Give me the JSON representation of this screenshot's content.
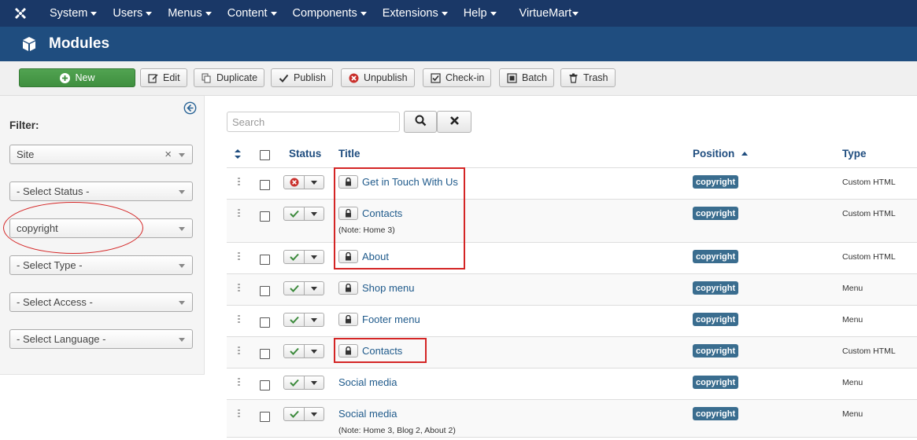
{
  "nav": {
    "items": [
      {
        "label": "System"
      },
      {
        "label": "Users"
      },
      {
        "label": "Menus"
      },
      {
        "label": "Content"
      },
      {
        "label": "Components"
      },
      {
        "label": "Extensions"
      },
      {
        "label": "Help"
      },
      {
        "label": "VirtueMart"
      }
    ]
  },
  "header": {
    "title": "Modules"
  },
  "toolbar": {
    "new": "New",
    "edit": "Edit",
    "duplicate": "Duplicate",
    "publish": "Publish",
    "unpublish": "Unpublish",
    "checkin": "Check-in",
    "batch": "Batch",
    "trash": "Trash"
  },
  "sidebar": {
    "filter_label": "Filter:",
    "site": "Site",
    "status": "- Select Status -",
    "position": "copyright",
    "type": "- Select Type -",
    "access": "- Select Access -",
    "language": "- Select Language -"
  },
  "search": {
    "placeholder": "Search"
  },
  "table": {
    "headers": {
      "status": "Status",
      "title": "Title",
      "position": "Position",
      "type": "Type"
    },
    "rows": [
      {
        "title": "Get in Touch With Us",
        "note": "",
        "published": false,
        "position": "copyright",
        "type": "Custom HTML",
        "locked": true
      },
      {
        "title": "Contacts",
        "note": "(Note: Home 3)",
        "published": true,
        "position": "copyright",
        "type": "Custom HTML",
        "locked": true
      },
      {
        "title": "About",
        "note": "",
        "published": true,
        "position": "copyright",
        "type": "Custom HTML",
        "locked": true
      },
      {
        "title": "Shop menu",
        "note": "",
        "published": true,
        "position": "copyright",
        "type": "Menu",
        "locked": true
      },
      {
        "title": "Footer menu",
        "note": "",
        "published": true,
        "position": "copyright",
        "type": "Menu",
        "locked": true
      },
      {
        "title": "Contacts",
        "note": "",
        "published": true,
        "position": "copyright",
        "type": "Custom HTML",
        "locked": true
      },
      {
        "title": "Social media",
        "note": "",
        "published": true,
        "position": "copyright",
        "type": "Menu",
        "locked": false
      },
      {
        "title": "Social media",
        "note": "(Note: Home 3, Blog 2, About 2)",
        "published": true,
        "position": "copyright",
        "type": "Menu",
        "locked": false
      }
    ]
  },
  "colors": {
    "nav_bg": "#1a3867",
    "header_bg": "#1f4d7f",
    "badge": "#3a6d8f",
    "highlight": "#d42525"
  }
}
